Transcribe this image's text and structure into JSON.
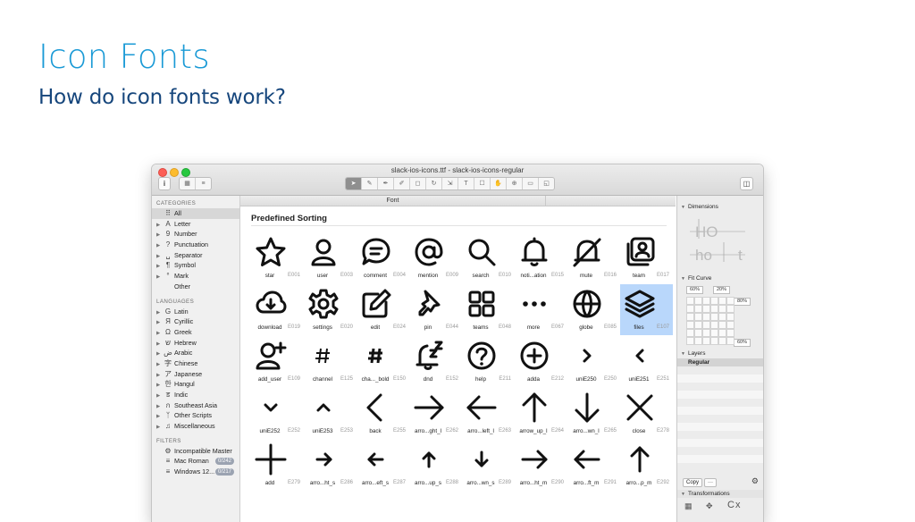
{
  "slide": {
    "title": "Icon Fonts",
    "subtitle": "How do icon fonts work?"
  },
  "window": {
    "title": "slack-ios-icons.ttf - slack-ios-icons-regular",
    "tab_label": "Font"
  },
  "sidebar": {
    "categories_header": "CATEGORIES",
    "categories": [
      {
        "label": "All",
        "icon": "grid-icon",
        "glyph": "⠿",
        "selected": true
      },
      {
        "label": "Letter",
        "icon": "letter-icon",
        "glyph": "A"
      },
      {
        "label": "Number",
        "icon": "number-icon",
        "glyph": "9"
      },
      {
        "label": "Punctuation",
        "icon": "punctuation-icon",
        "glyph": "?"
      },
      {
        "label": "Separator",
        "icon": "separator-icon",
        "glyph": "␣"
      },
      {
        "label": "Symbol",
        "icon": "symbol-icon",
        "glyph": "¶"
      },
      {
        "label": "Mark",
        "icon": "mark-icon",
        "glyph": "°"
      },
      {
        "label": "Other",
        "icon": "",
        "glyph": ""
      }
    ],
    "languages_header": "LANGUAGES",
    "languages": [
      {
        "label": "Latin",
        "glyph": "G"
      },
      {
        "label": "Cyrillic",
        "glyph": "Я"
      },
      {
        "label": "Greek",
        "glyph": "Ω"
      },
      {
        "label": "Hebrew",
        "glyph": "ש"
      },
      {
        "label": "Arabic",
        "glyph": "ض"
      },
      {
        "label": "Chinese",
        "glyph": "字"
      },
      {
        "label": "Japanese",
        "glyph": "ア"
      },
      {
        "label": "Hangul",
        "glyph": "한"
      },
      {
        "label": "Indic",
        "glyph": "ड"
      },
      {
        "label": "Southeast Asia",
        "glyph": "ก"
      },
      {
        "label": "Other Scripts",
        "glyph": "ᛉ"
      },
      {
        "label": "Miscellaneous",
        "glyph": "♫"
      }
    ],
    "filters_header": "FILTERS",
    "filters": [
      {
        "label": "Incompatible Master",
        "glyph": "⚙",
        "badge": ""
      },
      {
        "label": "Mac Roman",
        "glyph": "≡",
        "badge": "0/242"
      },
      {
        "label": "Windows 12...",
        "glyph": "≡",
        "badge": "0/217"
      }
    ]
  },
  "main": {
    "section_title": "Predefined Sorting",
    "glyphs": [
      {
        "name": "star",
        "code": "E001",
        "icon": "star-icon"
      },
      {
        "name": "user",
        "code": "E003",
        "icon": "user-icon"
      },
      {
        "name": "comment",
        "code": "E004",
        "icon": "comment-icon"
      },
      {
        "name": "mention",
        "code": "E009",
        "icon": "mention-icon"
      },
      {
        "name": "search",
        "code": "E010",
        "icon": "search-icon"
      },
      {
        "name": "noti...ation",
        "code": "E015",
        "icon": "bell-icon"
      },
      {
        "name": "mute",
        "code": "E016",
        "icon": "bell-off-icon"
      },
      {
        "name": "team",
        "code": "E017",
        "icon": "team-icon"
      },
      {
        "name": "download",
        "code": "E019",
        "icon": "cloud-download-icon"
      },
      {
        "name": "settings",
        "code": "E020",
        "icon": "gear-icon"
      },
      {
        "name": "edit",
        "code": "E024",
        "icon": "edit-icon"
      },
      {
        "name": "pin",
        "code": "E044",
        "icon": "pin-icon"
      },
      {
        "name": "teams",
        "code": "E048",
        "icon": "grid-squares-icon"
      },
      {
        "name": "more",
        "code": "E067",
        "icon": "more-icon"
      },
      {
        "name": "globe",
        "code": "E085",
        "icon": "globe-icon"
      },
      {
        "name": "files",
        "code": "E107",
        "icon": "layers-icon",
        "selected": true
      },
      {
        "name": "add_user",
        "code": "E109",
        "icon": "add-user-icon"
      },
      {
        "name": "channel",
        "code": "E125",
        "icon": "hash-icon"
      },
      {
        "name": "cha..._bold",
        "code": "E150",
        "icon": "hash-bold-icon"
      },
      {
        "name": "dnd",
        "code": "E152",
        "icon": "dnd-icon"
      },
      {
        "name": "help",
        "code": "E211",
        "icon": "help-icon"
      },
      {
        "name": "adda",
        "code": "E212",
        "icon": "add-circle-icon"
      },
      {
        "name": "uniE250",
        "code": "E250",
        "icon": "chevron-right-icon"
      },
      {
        "name": "uniE251",
        "code": "E251",
        "icon": "chevron-left-icon"
      },
      {
        "name": "uniE252",
        "code": "E252",
        "icon": "chevron-down-icon"
      },
      {
        "name": "uniE253",
        "code": "E253",
        "icon": "chevron-up-icon"
      },
      {
        "name": "back",
        "code": "E255",
        "icon": "back-icon"
      },
      {
        "name": "arro...ght_l",
        "code": "E262",
        "icon": "arrow-right-large-icon"
      },
      {
        "name": "arro...left_l",
        "code": "E263",
        "icon": "arrow-left-large-icon"
      },
      {
        "name": "arrow_up_l",
        "code": "E264",
        "icon": "arrow-up-large-icon"
      },
      {
        "name": "arro...wn_l",
        "code": "E265",
        "icon": "arrow-down-large-icon"
      },
      {
        "name": "close",
        "code": "E278",
        "icon": "close-icon"
      },
      {
        "name": "add",
        "code": "E279",
        "icon": "plus-icon"
      },
      {
        "name": "arro...ht_s",
        "code": "E286",
        "icon": "arrow-right-small-icon"
      },
      {
        "name": "arro...eft_s",
        "code": "E287",
        "icon": "arrow-left-small-icon"
      },
      {
        "name": "arro...up_s",
        "code": "E288",
        "icon": "arrow-up-small-icon"
      },
      {
        "name": "arro...wn_s",
        "code": "E289",
        "icon": "arrow-down-small-icon"
      },
      {
        "name": "arro...ht_m",
        "code": "E290",
        "icon": "arrow-right-medium-icon"
      },
      {
        "name": "arro...ft_m",
        "code": "E291",
        "icon": "arrow-left-medium-icon"
      },
      {
        "name": "arro...p_m",
        "code": "E292",
        "icon": "arrow-up-medium-icon"
      }
    ]
  },
  "right_panel": {
    "dimensions_label": "Dimensions",
    "dimensions_sample_upper": "HO",
    "dimensions_sample_lower": "ho",
    "dimensions_sample_t": "t",
    "fit_curve_label": "Fit Curve",
    "fit_values": [
      "60%",
      "20%",
      "80%",
      "60%"
    ],
    "layers_label": "Layers",
    "layer_regular": "Regular",
    "copy_label": "Copy",
    "more_label": "···",
    "transformations_label": "Transformations"
  },
  "colors": {
    "title": "#1a9ad6",
    "subtitle": "#16467c",
    "selection": "#b9d7fb"
  }
}
